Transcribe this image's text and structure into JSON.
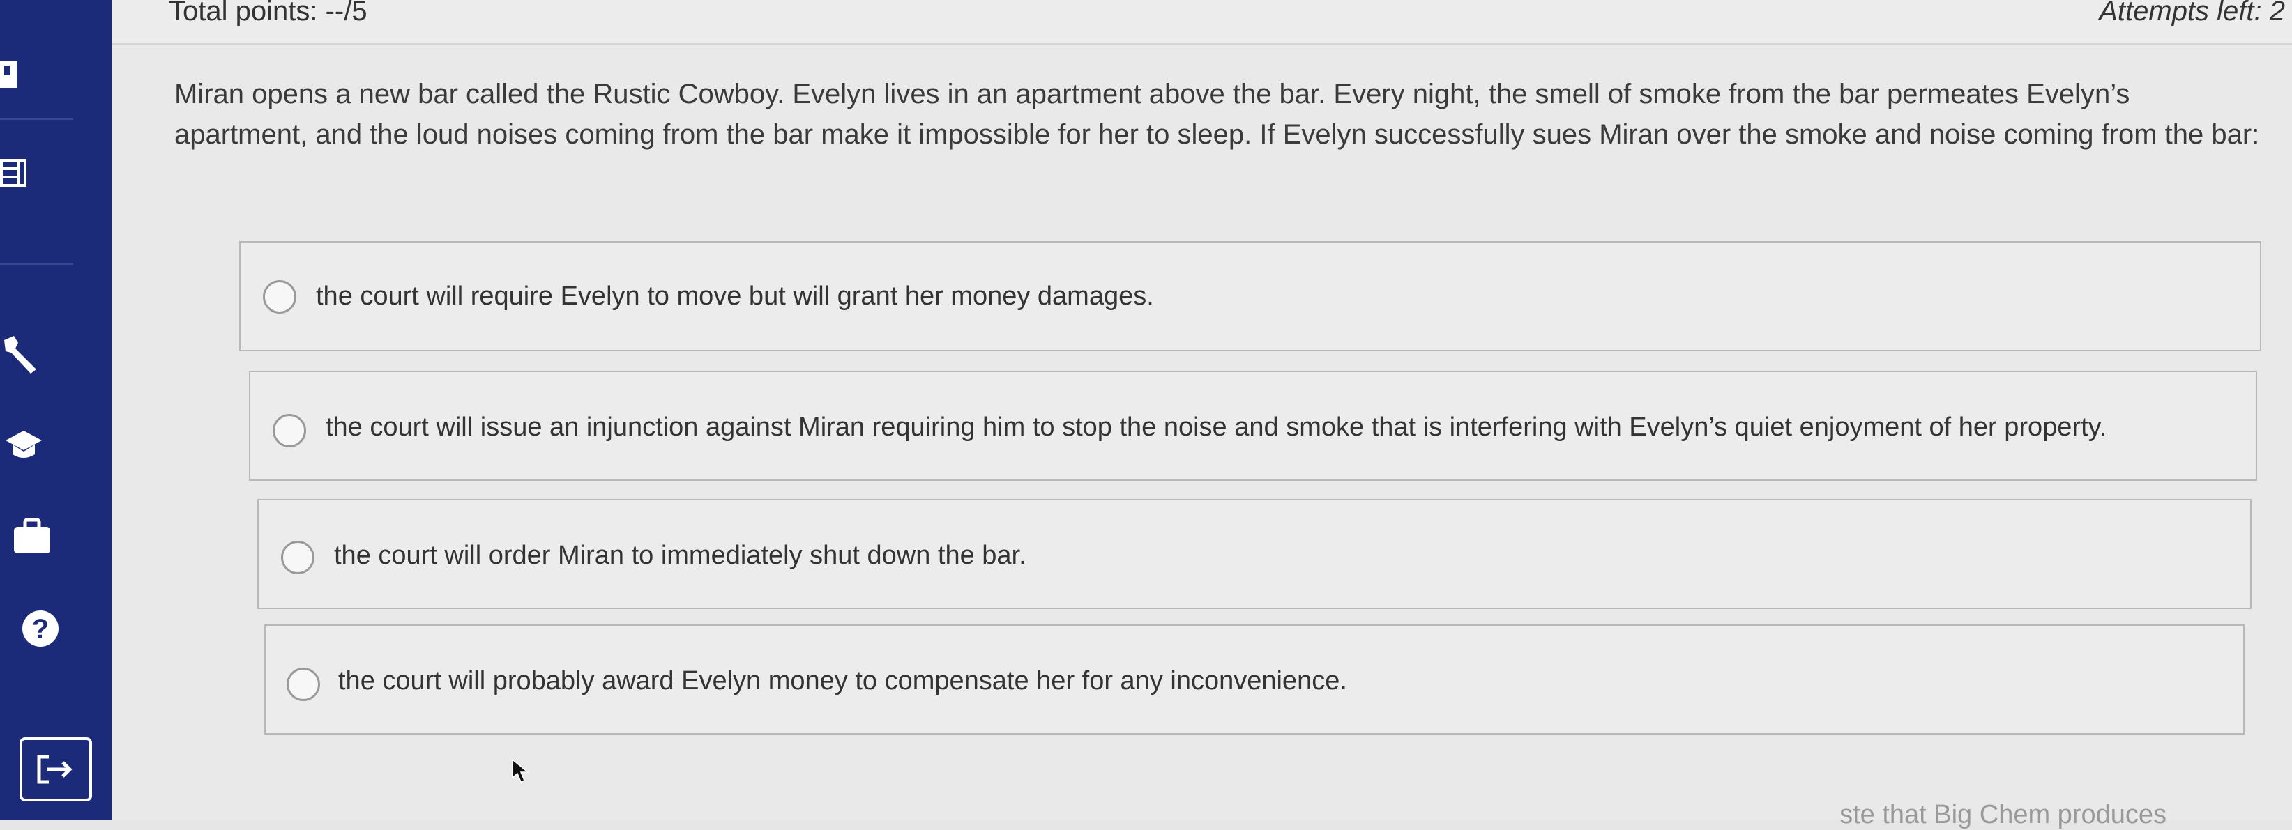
{
  "header": {
    "total_points": "Total points: --/5",
    "attempts_left": "Attempts left: 2"
  },
  "question": {
    "text": "Miran opens a new bar called the Rustic Cowboy. Evelyn lives in an apartment above the bar. Every night, the smell of smoke from the bar permeates Evelyn’s apartment, and the loud noises coming from the bar make it impossible for her to sleep. If Evelyn successfully sues Miran over the smoke and noise coming from the bar:"
  },
  "options": [
    {
      "label": "the court will require Evelyn to move but will grant her money damages."
    },
    {
      "label": "the court will issue an injunction against Miran requiring him to stop the noise and smoke that is interfering with Evelyn’s quiet enjoyment of her property."
    },
    {
      "label": "the court will order Miran to immediately shut down the bar."
    },
    {
      "label": "the court will probably award Evelyn money to compensate her for any inconvenience."
    }
  ],
  "footer": {
    "partial_text": "ste that Big Chem produces"
  },
  "sidebar": {
    "icons": [
      "book-icon",
      "gradebook-icon",
      "wrench-icon",
      "graduation-cap-icon",
      "briefcase-icon",
      "help-icon",
      "exit-icon"
    ]
  },
  "colors": {
    "sidebar": "#1c2a7a",
    "background": "#e9e9e9"
  }
}
